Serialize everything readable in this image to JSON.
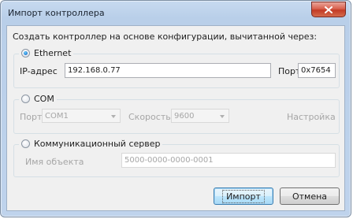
{
  "window": {
    "title": "Импорт контроллера"
  },
  "header": {
    "text": "Создать контроллер на основе конфигурации, вычитанной через:"
  },
  "ethernet": {
    "label": "Ethernet",
    "selected": true,
    "ip_label": "IP-адрес",
    "ip_value": "192.168.0.77",
    "port_label": "Порт",
    "port_value": "0x7654"
  },
  "com": {
    "label": "COM",
    "selected": false,
    "port_label": "Порт",
    "port_value": "COM1",
    "speed_label": "Скорость",
    "speed_value": "9600",
    "settings_label": "Настройка"
  },
  "comm_server": {
    "label": "Коммуникационный сервер",
    "selected": false,
    "object_name_label": "Имя объекта",
    "object_name_value": "5000-0000-0000-0001"
  },
  "buttons": {
    "import_label": "Импорт",
    "cancel_label": "Отмена"
  },
  "colors": {
    "title_bar": "#bfd3ec",
    "close_button": "#c23b25",
    "dialog_background": "#f0f0f0",
    "default_button": "#bee6fd"
  }
}
